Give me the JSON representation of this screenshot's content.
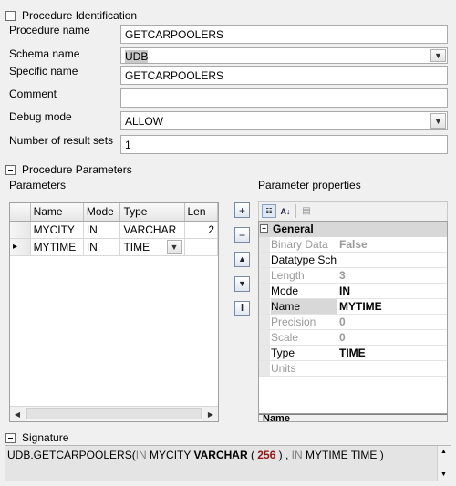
{
  "sections": {
    "identification": "Procedure Identification",
    "parameters": "Procedure Parameters",
    "signature": "Signature"
  },
  "identification": {
    "procedure_name_label": "Procedure name",
    "procedure_name_value": "GETCARPOOLERS",
    "schema_name_label": "Schema name",
    "schema_name_value": "UDB",
    "specific_name_label": "Specific name",
    "specific_name_value": "GETCARPOOLERS",
    "comment_label": "Comment",
    "comment_value": "",
    "debug_mode_label": "Debug mode",
    "debug_mode_value": "ALLOW",
    "result_sets_label": "Number of result sets",
    "result_sets_value": "1"
  },
  "parameters": {
    "title": "Parameters",
    "columns": [
      "Name",
      "Mode",
      "Type",
      "Len"
    ],
    "rows": [
      {
        "indicator": "",
        "name": "MYCITY",
        "mode": "IN",
        "type": "VARCHAR",
        "len": "2"
      },
      {
        "indicator": "▸",
        "name": "MYTIME",
        "mode": "IN",
        "type": "TIME",
        "len": ""
      }
    ],
    "side_buttons": [
      "add-icon",
      "remove-icon",
      "move-up-icon",
      "move-down-icon",
      "info-icon"
    ]
  },
  "properties": {
    "title": "Parameter properties",
    "category": "General",
    "rows": [
      {
        "name": "Binary Data",
        "value": "False",
        "enabled": false
      },
      {
        "name": "Datatype Sch",
        "value": "",
        "enabled": true
      },
      {
        "name": "Length",
        "value": "3",
        "enabled": false
      },
      {
        "name": "Mode",
        "value": "IN",
        "enabled": true
      },
      {
        "name": "Name",
        "value": "MYTIME",
        "enabled": true
      },
      {
        "name": "Precision",
        "value": "0",
        "enabled": false
      },
      {
        "name": "Scale",
        "value": "0",
        "enabled": false
      },
      {
        "name": "Type",
        "value": "TIME",
        "enabled": true
      },
      {
        "name": "Units",
        "value": "",
        "enabled": false
      }
    ],
    "description_title": "Name"
  },
  "signature": {
    "prefix": "UDB.GETCARPOOLERS(",
    "p1_mode": "IN",
    "p1_name": " MYCITY ",
    "p1_type": "VARCHAR",
    "p1_open": " ( ",
    "p1_len": "256",
    "p1_close": " ) ",
    "sep": ", ",
    "p2_mode": "IN",
    "p2_rest": " MYTIME TIME )"
  },
  "colors": {
    "background": "#f0f0f0",
    "selected_row": "#d8d8d8",
    "signature_bg": "#e4e4e4",
    "number_red": "#8b1a1a"
  }
}
